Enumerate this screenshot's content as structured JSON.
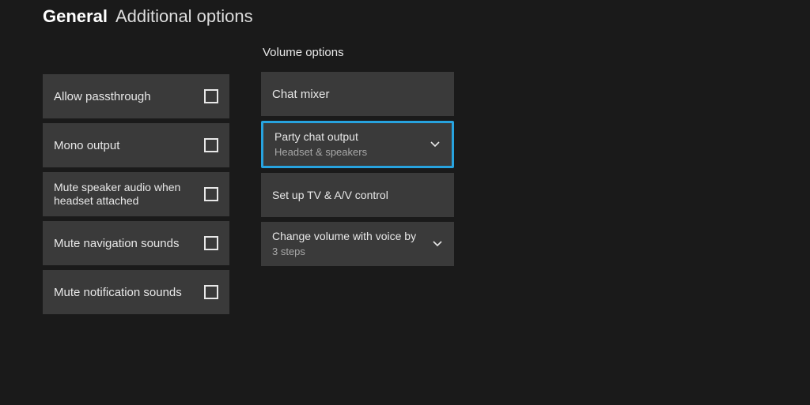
{
  "header": {
    "crumb1": "General",
    "crumb2": "Additional options"
  },
  "left": {
    "items": [
      {
        "label": "Allow passthrough",
        "checked": false
      },
      {
        "label": "Mono output",
        "checked": false
      },
      {
        "label": "Mute speaker audio when headset attached",
        "checked": false
      },
      {
        "label": "Mute navigation sounds",
        "checked": false
      },
      {
        "label": "Mute notification sounds",
        "checked": false
      }
    ]
  },
  "right": {
    "section_title": "Volume options",
    "items": [
      {
        "type": "link",
        "label": "Chat mixer"
      },
      {
        "type": "dropdown",
        "label": "Party chat output",
        "value": "Headset & speakers",
        "selected": true
      },
      {
        "type": "link",
        "label": "Set up TV & A/V control"
      },
      {
        "type": "dropdown",
        "label": "Change volume with voice by",
        "value": "3 steps",
        "selected": false
      }
    ]
  },
  "colors": {
    "accent": "#27a3df"
  }
}
